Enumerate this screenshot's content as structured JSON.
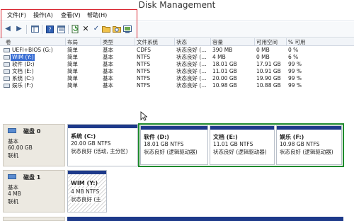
{
  "window": {
    "title": "Disk Management"
  },
  "menu": [
    {
      "label": "文件(F)"
    },
    {
      "label": "操作(A)"
    },
    {
      "label": "查看(V)"
    },
    {
      "label": "帮助(H)"
    }
  ],
  "toolbar": {
    "icons": [
      "back-icon",
      "forward-icon",
      "console-tree-icon",
      "help-icon",
      "properties-icon",
      "refresh-icon",
      "delete-icon",
      "check-icon",
      "open-icon",
      "search-icon",
      "console-icon"
    ]
  },
  "volume_table": {
    "headers": [
      "卷",
      "布局",
      "类型",
      "文件系统",
      "状态",
      "容量",
      "可用空间",
      "% 可用"
    ],
    "rows": [
      {
        "name": "UEFI+BIOS (G:)",
        "layout": "简单",
        "type": "基本",
        "fs": "CDFS",
        "status": "状态良好 (...",
        "capacity": "390 MB",
        "free": "0 MB",
        "pct": "0 %"
      },
      {
        "name": "WIM (Y:)",
        "layout": "简单",
        "type": "基本",
        "fs": "NTFS",
        "status": "状态良好 (...",
        "capacity": "4 MB",
        "free": "0 MB",
        "pct": "6 %"
      },
      {
        "name": "软件 (D:)",
        "layout": "简单",
        "type": "基本",
        "fs": "NTFS",
        "status": "状态良好 (...",
        "capacity": "18.01 GB",
        "free": "17.91 GB",
        "pct": "99 %"
      },
      {
        "name": "文档 (E:)",
        "layout": "简单",
        "type": "基本",
        "fs": "NTFS",
        "status": "状态良好 (...",
        "capacity": "11.01 GB",
        "free": "10.91 GB",
        "pct": "99 %"
      },
      {
        "name": "系统 (C:)",
        "layout": "简单",
        "type": "基本",
        "fs": "NTFS",
        "status": "状态良好 (...",
        "capacity": "20.00 GB",
        "free": "19.90 GB",
        "pct": "99 %"
      },
      {
        "name": "娱乐 (F:)",
        "layout": "简单",
        "type": "基本",
        "fs": "NTFS",
        "status": "状态良好 (...",
        "capacity": "10.98 GB",
        "free": "10.88 GB",
        "pct": "99 %"
      }
    ]
  },
  "disks": [
    {
      "name": "磁盘 0",
      "type": "基本",
      "size": "60.00 GB",
      "state": "联机",
      "partitions": [
        {
          "name": "系统 (C:)",
          "size": "20.00 GB NTFS",
          "status": "状态良好 (活动, 主分区)"
        },
        {
          "name": "软件 (D:)",
          "size": "18.01 GB NTFS",
          "status": "状态良好 (逻辑驱动器)"
        },
        {
          "name": "文档 (E:)",
          "size": "11.01 GB NTFS",
          "status": "状态良好 (逻辑驱动器)"
        },
        {
          "name": "娱乐 (F:)",
          "size": "10.98 GB NTFS",
          "status": "状态良好 (逻辑驱动器)"
        }
      ]
    },
    {
      "name": "磁盘 1",
      "type": "基本",
      "size": "4 MB",
      "state": "联机",
      "partitions": [
        {
          "name": "WIM (Y:)",
          "size": "4 MB NTFS",
          "status": "状态良好 (主"
        }
      ]
    }
  ],
  "colors": {
    "primary_bar": "#1e3a8a",
    "highlight_red": "#d8242f",
    "highlight_green": "#1e8a2c",
    "selection": "#3b6fd4"
  }
}
